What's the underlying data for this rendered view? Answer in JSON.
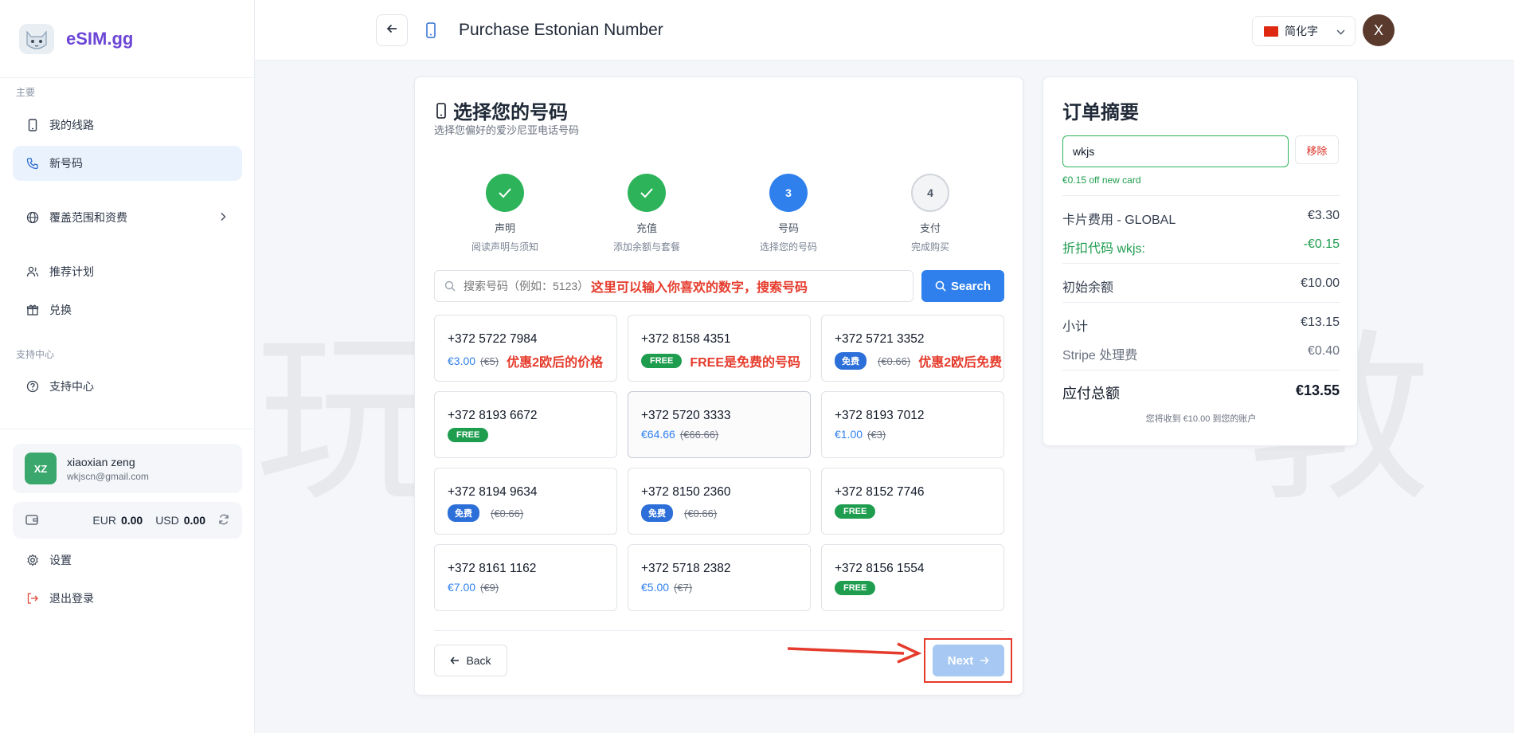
{
  "brand": {
    "name": "eSIM.gg",
    "logo_icon": "cat-logo-icon"
  },
  "sidebar": {
    "section_main": "主要",
    "items": [
      {
        "label": "我的线路",
        "icon": "phone-icon"
      },
      {
        "label": "新号码",
        "icon": "phone-call-icon",
        "active": true
      },
      {
        "label": "覆盖范围和资费",
        "icon": "globe-icon"
      },
      {
        "label": "推荐计划",
        "icon": "users-icon"
      },
      {
        "label": "兑换",
        "icon": "gift-icon"
      }
    ],
    "section_support": "支持中心",
    "support_item": {
      "label": "支持中心",
      "icon": "help-circle-icon"
    },
    "user": {
      "initials": "XZ",
      "name": "xiaoxian zeng",
      "email": "wkjscn@gmail.com"
    },
    "wallet": {
      "eur_label": "EUR",
      "eur_value": "0.00",
      "usd_label": "USD",
      "usd_value": "0.00"
    },
    "settings_label": "设置",
    "logout_label": "退出登录"
  },
  "header": {
    "title": "Purchase Estonian Number",
    "language": "简化字",
    "avatar_initial": "X"
  },
  "watermark": "玩 客 教 授",
  "main": {
    "title": "选择您的号码",
    "subtitle": "选择您偏好的爱沙尼亚电话号码",
    "steps": [
      {
        "label": "声明",
        "sub": "阅读声明与须知",
        "state": "done",
        "num": ""
      },
      {
        "label": "充值",
        "sub": "添加余额与套餐",
        "state": "done",
        "num": ""
      },
      {
        "label": "号码",
        "sub": "选择您的号码",
        "state": "current",
        "num": "3"
      },
      {
        "label": "支付",
        "sub": "完成购买",
        "state": "todo",
        "num": "4"
      }
    ],
    "search": {
      "placeholder": "搜索号码（例如：5123）",
      "annotation": "这里可以输入你喜欢的数字，搜索号码",
      "button": "Search"
    },
    "numbers": [
      {
        "number": "+372 5722 7984",
        "price": "€3.00",
        "original": "(€5)",
        "badge": "",
        "annotation": "优惠2欧后的价格"
      },
      {
        "number": "+372 8158 4351",
        "price": "",
        "original": "",
        "badge": "FREE",
        "annotation": "FREE是免费的号码"
      },
      {
        "number": "+372 5721 3352",
        "price": "",
        "original": "(€0.66)",
        "badge": "免费",
        "annotation": "优惠2欧后免费"
      },
      {
        "number": "+372 8193 6672",
        "price": "",
        "original": "",
        "badge": "FREE",
        "annotation": ""
      },
      {
        "number": "+372 5720 3333",
        "price": "€64.66",
        "original": "(€66.66)",
        "badge": "",
        "annotation": ""
      },
      {
        "number": "+372 8193 7012",
        "price": "€1.00",
        "original": "(€3)",
        "badge": "",
        "annotation": ""
      },
      {
        "number": "+372 8194 9634",
        "price": "",
        "original": "(€0.66)",
        "badge": "免费",
        "annotation": ""
      },
      {
        "number": "+372 8150 2360",
        "price": "",
        "original": "(€0.66)",
        "badge": "免费",
        "annotation": ""
      },
      {
        "number": "+372 8152 7746",
        "price": "",
        "original": "",
        "badge": "FREE",
        "annotation": ""
      },
      {
        "number": "+372 8161 1162",
        "price": "€7.00",
        "original": "(€9)",
        "badge": "",
        "annotation": ""
      },
      {
        "number": "+372 5718 2382",
        "price": "€5.00",
        "original": "(€7)",
        "badge": "",
        "annotation": ""
      },
      {
        "number": "+372 8156 1554",
        "price": "",
        "original": "",
        "badge": "FREE",
        "annotation": ""
      }
    ],
    "back_label": "Back",
    "next_label": "Next"
  },
  "summary": {
    "title": "订单摘要",
    "coupon_value": "wkjs",
    "remove_label": "移除",
    "coupon_note": "€0.15 off new card",
    "rows": [
      {
        "label": "卡片费用 - GLOBAL",
        "value": "€3.30"
      },
      {
        "label": "折扣代码 wkjs:",
        "value": "-€0.15"
      },
      {
        "label": "初始余额",
        "value": "€10.00"
      },
      {
        "label": "小计",
        "value": "€13.15"
      },
      {
        "label": "Stripe 处理费",
        "value": "€0.40"
      },
      {
        "label": "应付总额",
        "value": "€13.55"
      }
    ],
    "footnote": "您将收到 €10.00 到您的账户"
  },
  "colors": {
    "primary": "#2f80ed",
    "success": "#2db35a",
    "annotation": "#e53b2c",
    "brand": "#6b46d6"
  }
}
